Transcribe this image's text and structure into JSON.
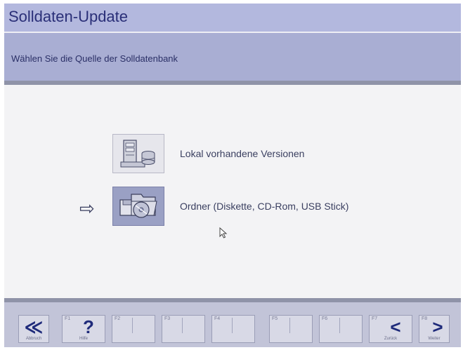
{
  "window": {
    "title": "Solldaten-Update",
    "instruction": "Wählen Sie die Quelle der Solldatenbank"
  },
  "options": [
    {
      "label": "Lokal vorhandene Versionen",
      "icon": "local-server-icon",
      "selected": false
    },
    {
      "label": "Ordner (Diskette, CD-Rom, USB Stick)",
      "icon": "folder-media-icon",
      "selected": true
    }
  ],
  "selection_indicator": "⇨",
  "function_keys": [
    {
      "num": "",
      "glyph": "≪",
      "caption": "Abbruch"
    },
    {
      "num": "F1",
      "glyph": "?",
      "caption": "Hilfe"
    },
    {
      "num": "F2",
      "glyph": "",
      "caption": ""
    },
    {
      "num": "F3",
      "glyph": "",
      "caption": ""
    },
    {
      "num": "F4",
      "glyph": "",
      "caption": ""
    },
    {
      "num": "F5",
      "glyph": "",
      "caption": ""
    },
    {
      "num": "F6",
      "glyph": "",
      "caption": ""
    },
    {
      "num": "F7",
      "glyph": "<",
      "caption": "Zurück"
    },
    {
      "num": "F8",
      "glyph": ">",
      "caption": "Weiter"
    }
  ],
  "colors": {
    "title_bar": "#b3b8de",
    "title_text": "#2a2f78",
    "content_bg": "#f3f3f5",
    "selected_icon_bg": "#9aa0c4",
    "function_glyph": "#1e2a7a"
  }
}
